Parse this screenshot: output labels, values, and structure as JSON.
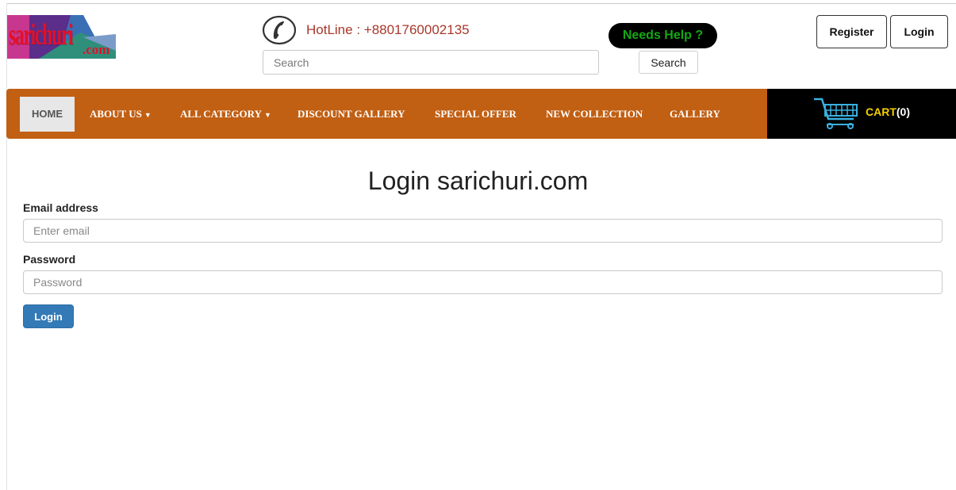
{
  "brand": {
    "logo_text": "sarichuri",
    "logo_domain": ".com"
  },
  "header": {
    "phone_icon": "phone-icon",
    "hotline": "HotLine : +8801760002135",
    "search_placeholder": "Search",
    "search_button": "Search",
    "help_label": "Needs Help ?",
    "register_label": "Register",
    "login_label": "Login"
  },
  "nav": {
    "home": "HOME",
    "about": "ABOUT US",
    "category": "ALL CATEGORY",
    "discount": "DISCOUNT GALLERY",
    "special": "SPECIAL OFFER",
    "new_collection": "NEW COLLECTION",
    "gallery": "GALLERY",
    "caret_icon": "caret-down-icon",
    "bar_color": "#c15f13"
  },
  "cart": {
    "icon": "shopping-cart-icon",
    "label": "CART",
    "count": "(0)"
  },
  "main": {
    "title": "Login sarichuri.com",
    "email_label": "Email address",
    "email_placeholder": "Enter email",
    "password_label": "Password",
    "password_placeholder": "Password",
    "submit_label": "Login"
  }
}
